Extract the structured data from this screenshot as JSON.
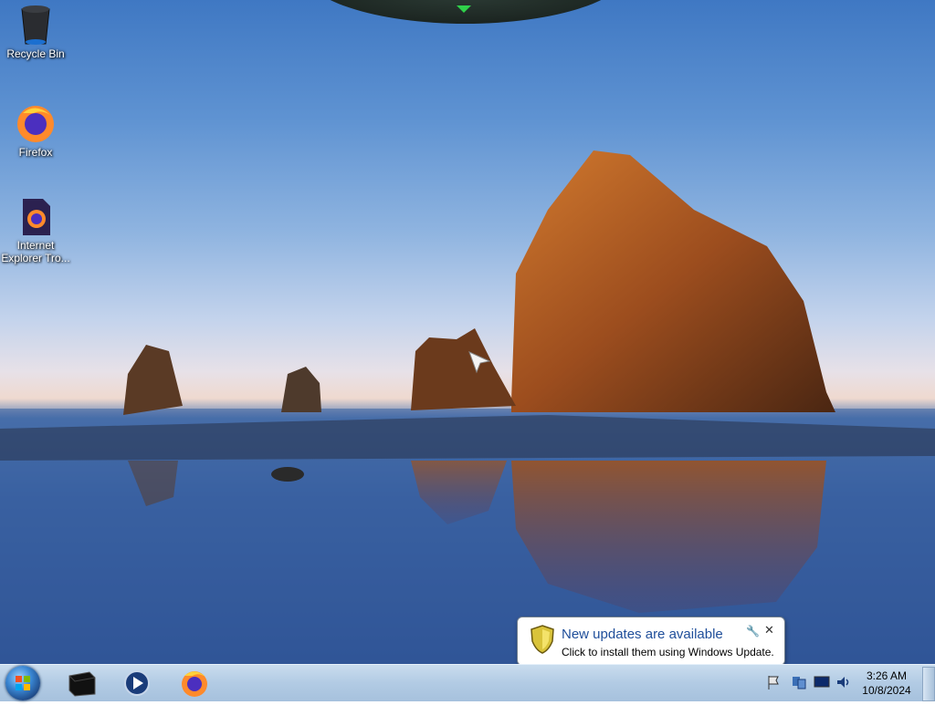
{
  "desktop": {
    "icons": [
      {
        "label": "Recycle Bin",
        "icon": "recycle-bin-icon"
      },
      {
        "label": "Firefox",
        "icon": "firefox-icon"
      },
      {
        "label": "Internet Explorer Tro...",
        "icon": "firefox-document-icon"
      }
    ]
  },
  "taskbar": {
    "pinned": [
      {
        "name": "windows-explorer",
        "icon": "black-box-icon"
      },
      {
        "name": "media-player",
        "icon": "media-player-icon"
      },
      {
        "name": "firefox",
        "icon": "firefox-icon"
      }
    ],
    "tray": {
      "icons": [
        "action-center-flag-icon",
        "network-icon",
        "display-icon",
        "volume-icon"
      ],
      "time": "3:26 AM",
      "date": "10/8/2024"
    }
  },
  "notification": {
    "title": "New updates are available",
    "text": "Click to install them using Windows Update.",
    "icon": "shield-icon"
  },
  "colors": {
    "accent": "#1f4e9a",
    "taskbar": "#b2cbe4"
  }
}
